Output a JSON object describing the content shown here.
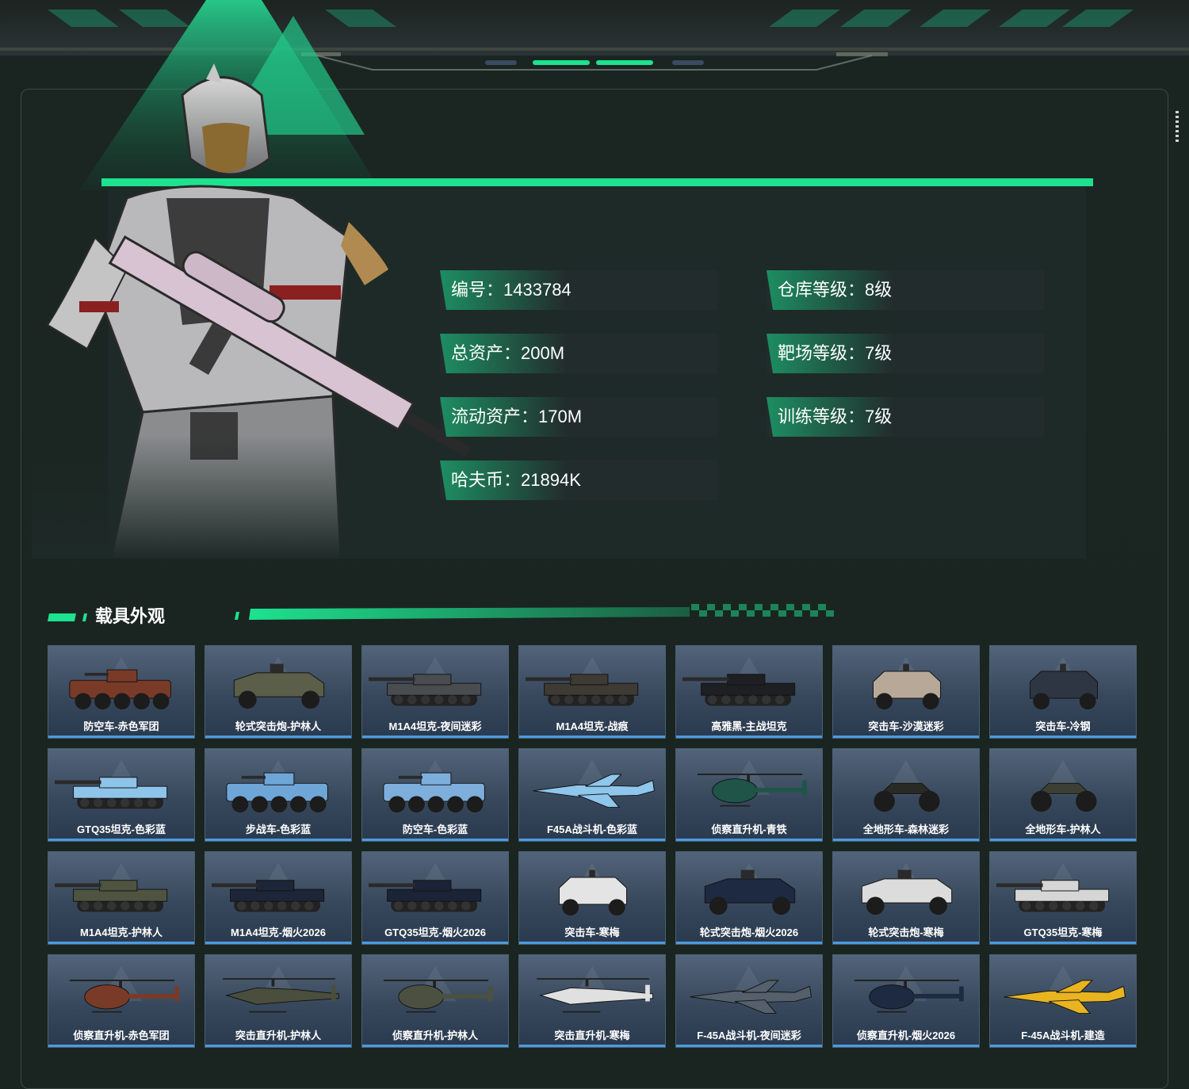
{
  "stats": [
    {
      "label": "编号：",
      "value": "1433784"
    },
    {
      "label": "仓库等级：",
      "value": "8级"
    },
    {
      "label": "总资产：",
      "value": "200M"
    },
    {
      "label": "靶场等级：",
      "value": "7级"
    },
    {
      "label": "流动资产：",
      "value": "170M"
    },
    {
      "label": "训练等级：",
      "value": "7级"
    },
    {
      "label": "哈夫币：",
      "value": "21894K"
    }
  ],
  "section": {
    "title": "载具外观"
  },
  "vehicles": [
    {
      "label": "防空车-赤色军团",
      "icon": "apc-icon",
      "color": "#7a3a28"
    },
    {
      "label": "轮式突击炮-护林人",
      "icon": "armored-car-icon",
      "color": "#5b5e48"
    },
    {
      "label": "M1A4坦克-夜间迷彩",
      "icon": "tank-icon",
      "color": "#4a4d50"
    },
    {
      "label": "M1A4坦克-战痕",
      "icon": "tank-icon",
      "color": "#3e3a34"
    },
    {
      "label": "高雅黑-主战坦克",
      "icon": "tank-icon",
      "color": "#1e1f22"
    },
    {
      "label": "突击车-沙漠迷彩",
      "icon": "assault-car-icon",
      "color": "#b8a898"
    },
    {
      "label": "突击车-冷钢",
      "icon": "assault-car-icon",
      "color": "#2e3644"
    },
    {
      "label": "GTQ35坦克-色彩蓝",
      "icon": "tank-icon",
      "color": "#8fc4ea"
    },
    {
      "label": "步战车-色彩蓝",
      "icon": "apc-icon",
      "color": "#6fa6d8"
    },
    {
      "label": "防空车-色彩蓝",
      "icon": "apc-icon",
      "color": "#7eaedc"
    },
    {
      "label": "F45A战斗机-色彩蓝",
      "icon": "jet-icon",
      "color": "#8ec6ec"
    },
    {
      "label": "侦察直升机-青铁",
      "icon": "helicopter-icon",
      "color": "#1f5548"
    },
    {
      "label": "全地形车-森林迷彩",
      "icon": "atv-icon",
      "color": "#2a2a24"
    },
    {
      "label": "全地形车-护林人",
      "icon": "atv-icon",
      "color": "#3c4034"
    },
    {
      "label": "M1A4坦克-护林人",
      "icon": "tank-icon",
      "color": "#4f5440"
    },
    {
      "label": "M1A4坦克-烟火2026",
      "icon": "tank-icon",
      "color": "#1c2638"
    },
    {
      "label": "GTQ35坦克-烟火2026",
      "icon": "tank-icon",
      "color": "#1a2436"
    },
    {
      "label": "突击车-寒梅",
      "icon": "assault-car-icon",
      "color": "#e4e4e4"
    },
    {
      "label": "轮式突击炮-烟火2026",
      "icon": "armored-car-icon",
      "color": "#1d2a42"
    },
    {
      "label": "轮式突击炮-寒梅",
      "icon": "armored-car-icon",
      "color": "#dcdcdc"
    },
    {
      "label": "GTQ35坦克-寒梅",
      "icon": "tank-icon",
      "color": "#d6d6d6"
    },
    {
      "label": "侦察直升机-赤色军团",
      "icon": "helicopter-icon",
      "color": "#7a3a28"
    },
    {
      "label": "突击直升机-护林人",
      "icon": "attack-helicopter-icon",
      "color": "#4a4e3c"
    },
    {
      "label": "侦察直升机-护林人",
      "icon": "helicopter-icon",
      "color": "#4c5040"
    },
    {
      "label": "突击直升机-寒梅",
      "icon": "attack-helicopter-icon",
      "color": "#e0e0e0"
    },
    {
      "label": "F-45A战斗机-夜间迷彩",
      "icon": "jet-icon",
      "color": "#55606c"
    },
    {
      "label": "侦察直升机-烟火2026",
      "icon": "helicopter-icon",
      "color": "#1d2a42"
    },
    {
      "label": "F-45A战斗机-建造",
      "icon": "jet-icon",
      "color": "#e8b420"
    }
  ]
}
